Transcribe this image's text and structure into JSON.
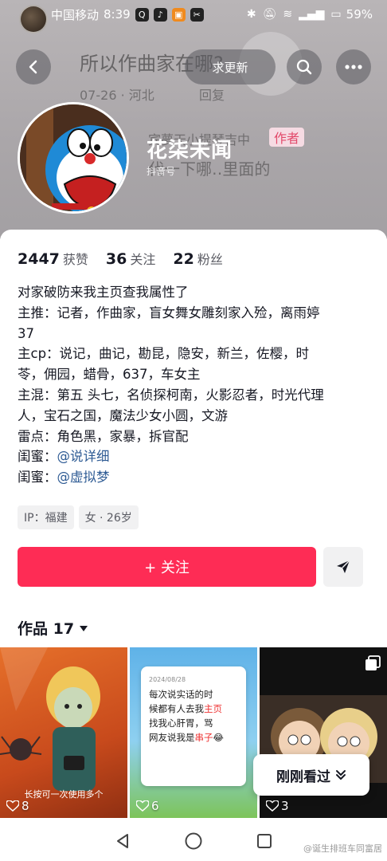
{
  "status_bar": {
    "carrier": "中国移动",
    "time": "8:39",
    "battery": "59%"
  },
  "background_comment": {
    "text": "所以作曲家在哪?",
    "meta_date": "07-26 · 河北",
    "reply_label": "回复",
    "behind_text": "宾夢天小提琴吉中",
    "author_badge": "作者",
    "behind_text2": "代一下哪‥里面的"
  },
  "header": {
    "update_button": "求更新",
    "back_icon": "back-arrow-icon",
    "search_icon": "search-icon",
    "more_icon": "more-icon"
  },
  "profile": {
    "name": "花柒未闻",
    "douyin_id_label": "抖音号"
  },
  "stats": [
    {
      "num": "2447",
      "label": "获赞"
    },
    {
      "num": "36",
      "label": "关注"
    },
    {
      "num": "22",
      "label": "粉丝"
    }
  ],
  "bio": {
    "line1": "对家破防来我主页查我属性了",
    "line2": "主推：记者，作曲家，盲女舞女雕刻家入殓，离雨婷",
    "line3": "37",
    "line4": "主cp：说记，曲记，勘昆，隐安，新兰，佐樱，时",
    "line5": "苓，佣园，蜡骨，637，车女主",
    "line6": "主混：第五 头七，名侦探柯南，火影忍者，时光代理",
    "line7": "人，宝石之国，魔法少女小圆，文游",
    "line8": "雷点：角色黑，家暴，拆官配",
    "bff1_label": "闺蜜：",
    "bff1_mention": "@说详细",
    "bff2_label": "闺蜜：",
    "bff2_mention": "@虚拟梦"
  },
  "tags": {
    "ip": "IP：福建",
    "gender_age": "女 · 26岁"
  },
  "actions": {
    "follow": "+ 关注"
  },
  "works": {
    "label": "作品 17"
  },
  "grid": [
    {
      "likes": "8",
      "caption": "长按可一次使用多个"
    },
    {
      "likes": "6",
      "note_header": "2024/08/28",
      "note_l1": "每次说实话的时",
      "note_l2": "候都有人去我",
      "note_hl1": "主页",
      "note_l3": "找我心肝胃，骂",
      "note_l4": "网友说我是",
      "note_hl2": "串子"
    },
    {
      "likes": "3"
    }
  ],
  "recent_button": "刚刚看过",
  "watermark": "@诞生排班车同富居"
}
